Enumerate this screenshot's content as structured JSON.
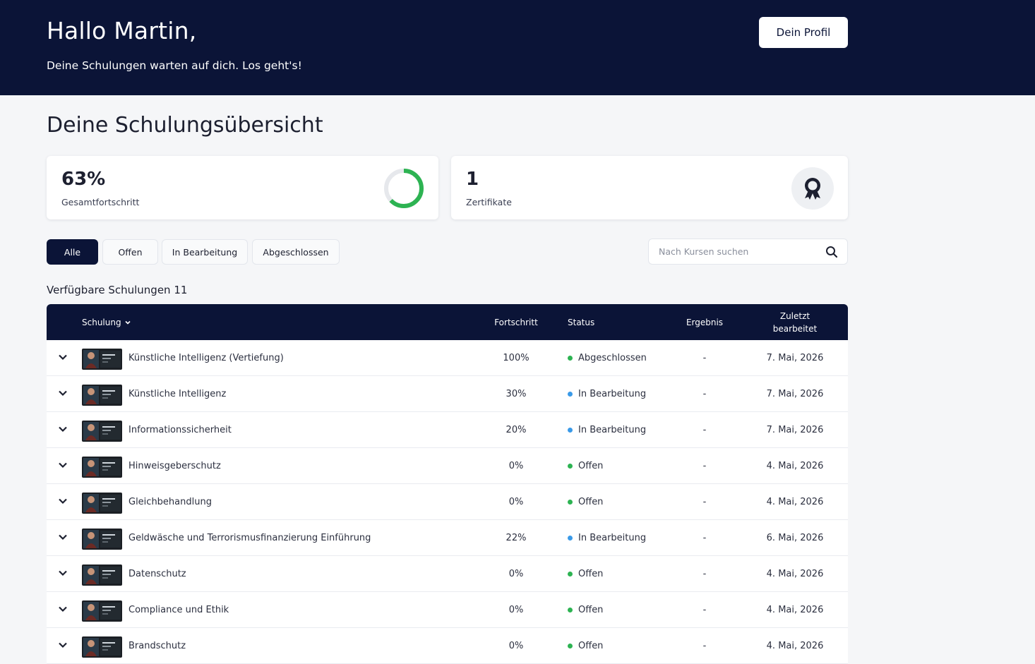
{
  "header": {
    "greeting": "Hallo Martin,",
    "subtitle": "Deine Schulungen warten auf dich. Los geht's!",
    "profile_button": "Dein Profil"
  },
  "page_title": "Deine Schulungsübersicht",
  "stats": {
    "progress": {
      "value": "63%",
      "label": "Gesamtfortschritt",
      "fraction": 0.63,
      "icon": "progress-donut-icon",
      "color": "#2db352"
    },
    "certificates": {
      "value": "1",
      "label": "Zertifikate",
      "icon": "award-ribbon-icon"
    }
  },
  "filters": [
    {
      "label": "Alle",
      "active": true
    },
    {
      "label": "Offen",
      "active": false
    },
    {
      "label": "In Bearbeitung",
      "active": false
    },
    {
      "label": "Abgeschlossen",
      "active": false
    }
  ],
  "search": {
    "placeholder": "Nach Kursen suchen",
    "icon": "search-icon"
  },
  "list_heading": "Verfügbare Schulungen 11",
  "table": {
    "columns": {
      "course": "Schulung",
      "progress": "Fortschritt",
      "status": "Status",
      "result": "Ergebnis",
      "last_edited_line1": "Zuletzt",
      "last_edited_line2": "bearbeitet"
    },
    "rows": [
      {
        "title": "Künstliche Intelligenz (Vertiefung)",
        "progress": "100%",
        "status": "Abgeschlossen",
        "status_color": "#2db352",
        "result": "-",
        "date": "7. Mai, 2026"
      },
      {
        "title": "Künstliche Intelligenz",
        "progress": "30%",
        "status": "In Bearbeitung",
        "status_color": "#3a9ae8",
        "result": "-",
        "date": "7. Mai, 2026"
      },
      {
        "title": "Informationssicherheit",
        "progress": "20%",
        "status": "In Bearbeitung",
        "status_color": "#3a9ae8",
        "result": "-",
        "date": "7. Mai, 2026"
      },
      {
        "title": "Hinweisgeberschutz",
        "progress": "0%",
        "status": "Offen",
        "status_color": "#2db352",
        "result": "-",
        "date": "4. Mai, 2026"
      },
      {
        "title": "Gleichbehandlung",
        "progress": "0%",
        "status": "Offen",
        "status_color": "#2db352",
        "result": "-",
        "date": "4. Mai, 2026"
      },
      {
        "title": "Geldwäsche und Terrorismusfinanzierung Einführung",
        "progress": "22%",
        "status": "In Bearbeitung",
        "status_color": "#3a9ae8",
        "result": "-",
        "date": "6. Mai, 2026"
      },
      {
        "title": "Datenschutz",
        "progress": "0%",
        "status": "Offen",
        "status_color": "#2db352",
        "result": "-",
        "date": "4. Mai, 2026"
      },
      {
        "title": "Compliance und Ethik",
        "progress": "0%",
        "status": "Offen",
        "status_color": "#2db352",
        "result": "-",
        "date": "4. Mai, 2026"
      },
      {
        "title": "Brandschutz",
        "progress": "0%",
        "status": "Offen",
        "status_color": "#2db352",
        "result": "-",
        "date": "4. Mai, 2026"
      }
    ]
  },
  "colors": {
    "navy": "#0b1437",
    "green": "#2db352",
    "blue": "#3a9ae8"
  }
}
